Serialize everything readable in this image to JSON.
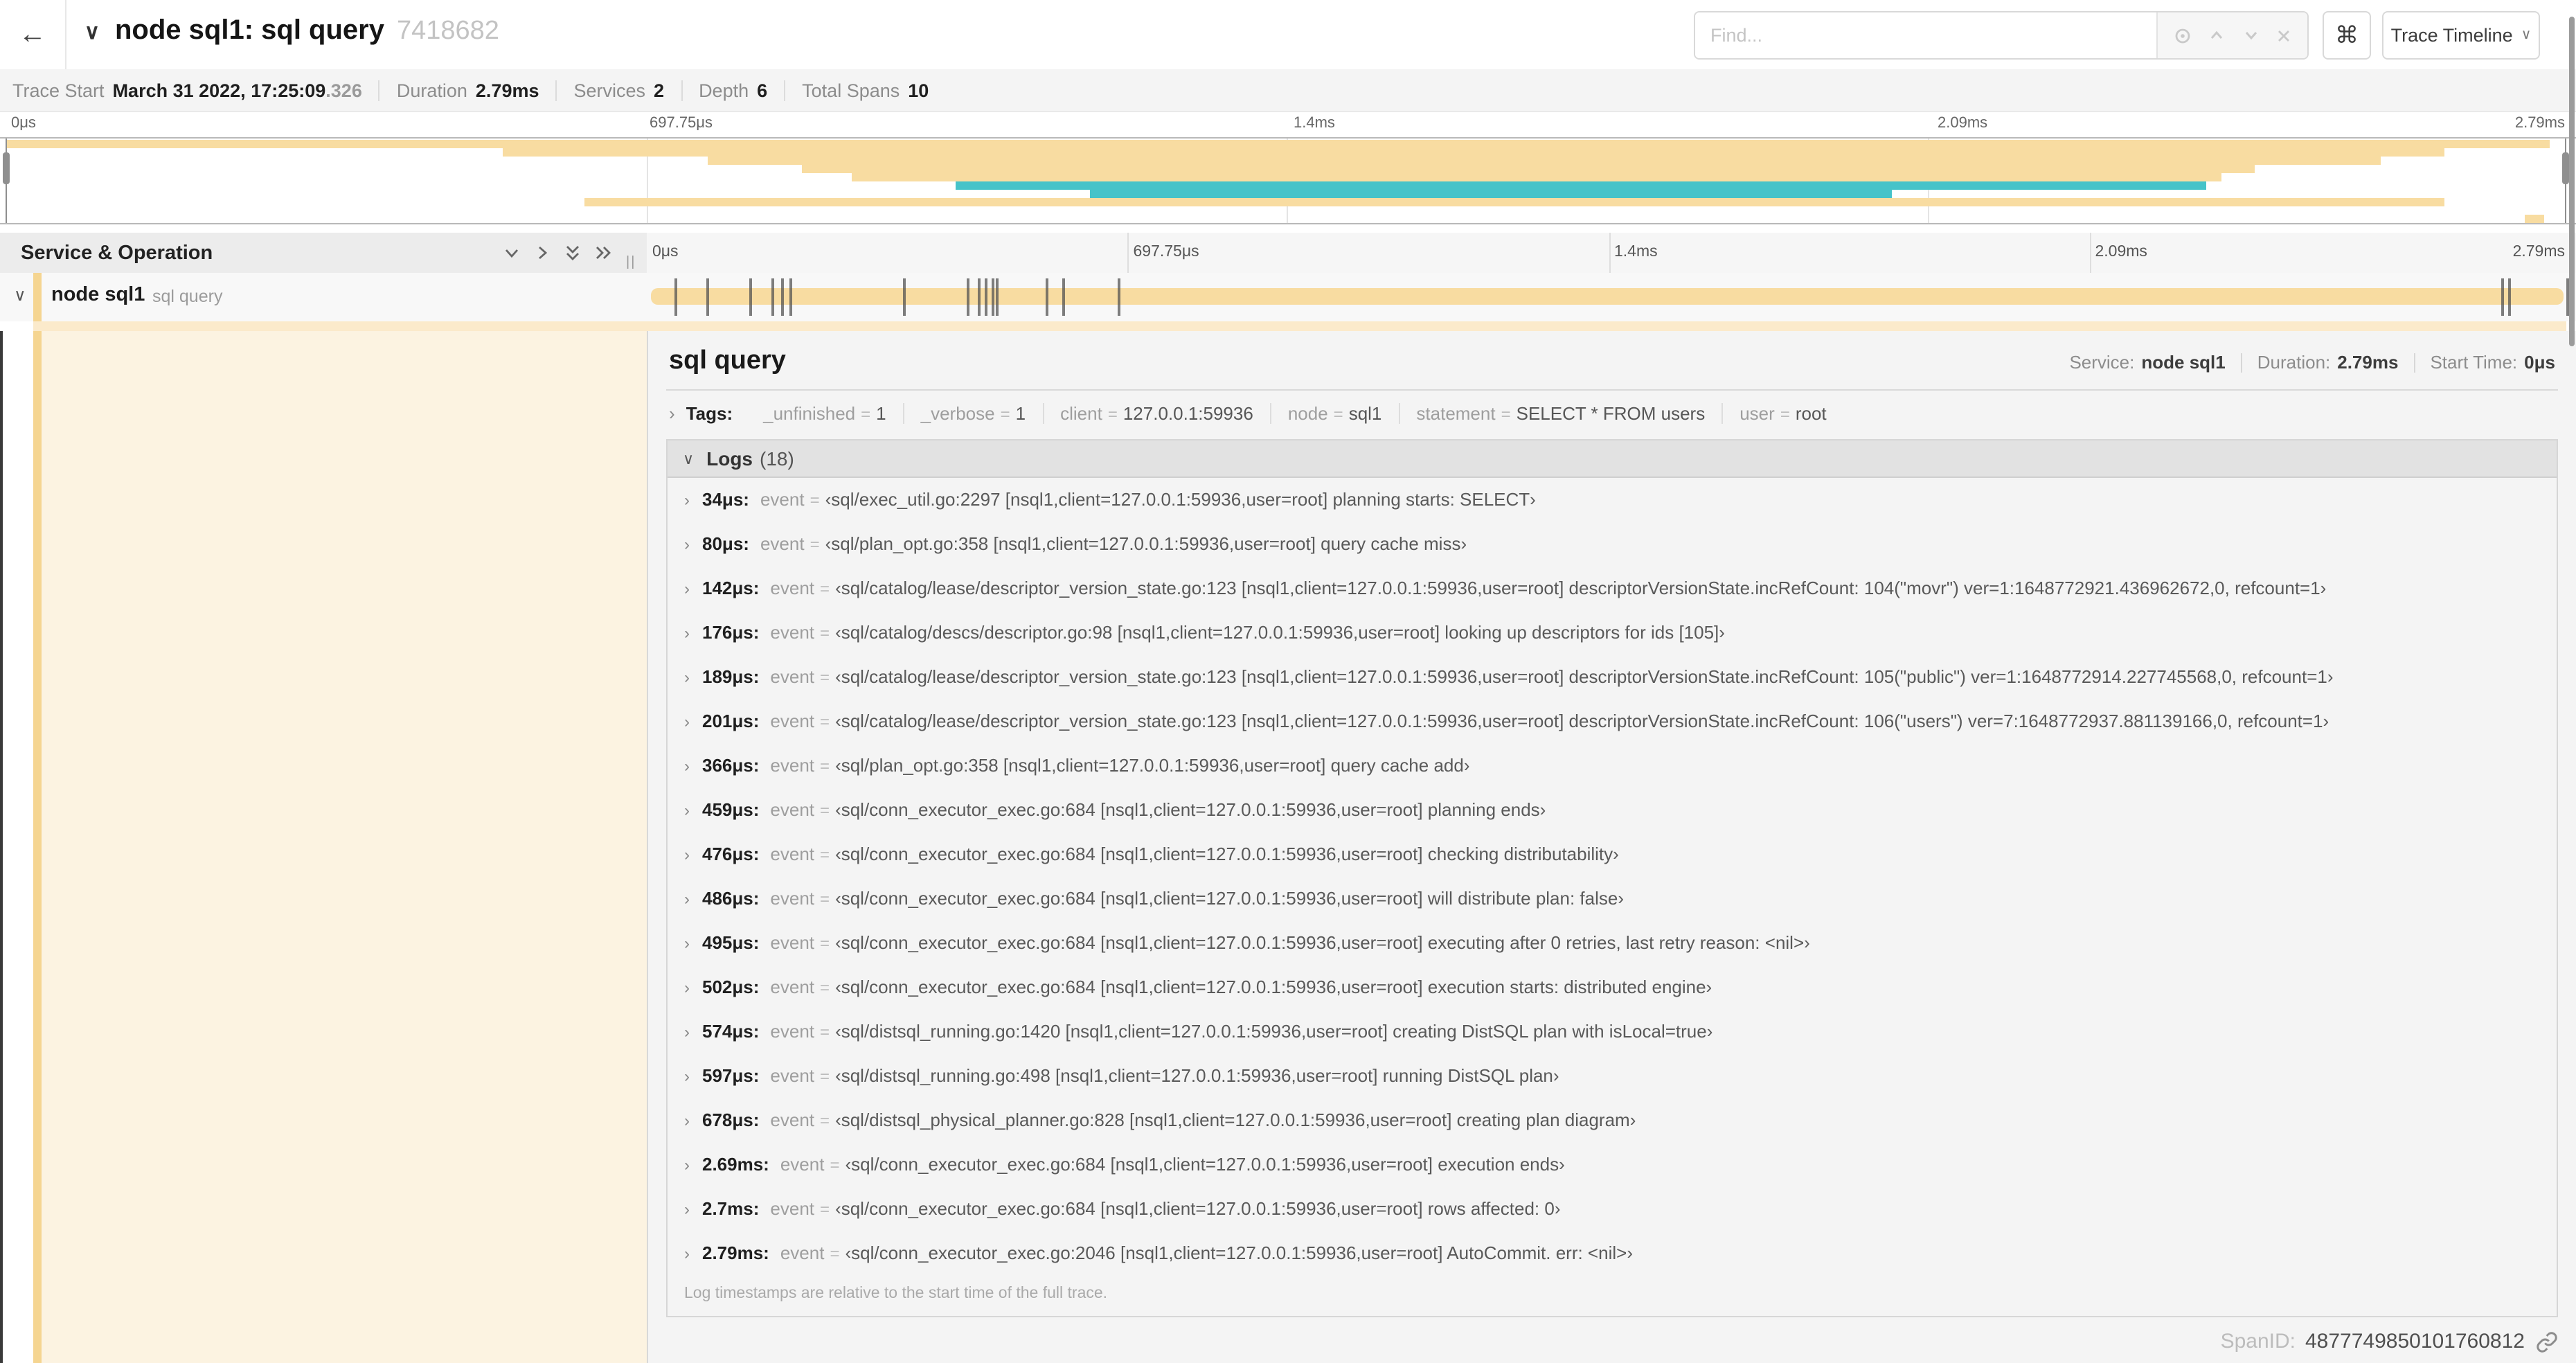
{
  "colors": {
    "tan": "#F8DCA1",
    "teal": "#46C3C9",
    "strip": "#F5D591",
    "band": "#FBEACB",
    "cream": "#FCF3E1"
  },
  "header": {
    "back_label": "←",
    "collapse_chevron": "∨",
    "title": "node sql1: sql query",
    "trace_id": "7418682",
    "find_placeholder": "Find...",
    "shortcut_label": "⌘",
    "view_select_label": "Trace Timeline"
  },
  "trace_info": {
    "items": [
      {
        "label": "Trace Start",
        "value": "March 31 2022, 17:25:09",
        "suffix": ".326"
      },
      {
        "label": "Duration",
        "value": "2.79ms",
        "suffix": ""
      },
      {
        "label": "Services",
        "value": "2",
        "suffix": ""
      },
      {
        "label": "Depth",
        "value": "6",
        "suffix": ""
      },
      {
        "label": "Total Spans",
        "value": "10",
        "suffix": ""
      }
    ]
  },
  "minimap": {
    "ticks": [
      {
        "label": "0μs",
        "pct": 0
      },
      {
        "label": "697.75μs",
        "pct": 25
      },
      {
        "label": "1.4ms",
        "pct": 50
      },
      {
        "label": "2.09ms",
        "pct": 75
      },
      {
        "label": "2.79ms",
        "pct": 100
      }
    ],
    "spans": [
      {
        "left": 0,
        "width": 99.3,
        "color": "tan"
      },
      {
        "left": 19.4,
        "width": 75.8,
        "color": "tan"
      },
      {
        "left": 27.4,
        "width": 65.3,
        "color": "tan"
      },
      {
        "left": 31.1,
        "width": 56.7,
        "color": "tan"
      },
      {
        "left": 33.0,
        "width": 53.5,
        "color": "tan"
      },
      {
        "left": 37.1,
        "width": 48.8,
        "color": "teal"
      },
      {
        "left": 42.3,
        "width": 31.3,
        "color": "teal"
      },
      {
        "left": 22.6,
        "width": 72.6,
        "color": "tan"
      },
      {
        "left": 0,
        "width": 0,
        "color": "tan"
      },
      {
        "left": 98.3,
        "width": 0.8,
        "color": "tan"
      }
    ]
  },
  "timeline": {
    "left_header": "Service & Operation",
    "splitter_glyph": "||",
    "ticks": [
      {
        "label": "0μs",
        "pct": 0
      },
      {
        "label": "697.75μs",
        "pct": 25
      },
      {
        "label": "1.4ms",
        "pct": 50
      },
      {
        "label": "2.09ms",
        "pct": 75
      },
      {
        "label": "2.79ms",
        "pct": 100
      }
    ],
    "row": {
      "chevron": "∨",
      "service": "node sql1",
      "operation": "sql query"
    },
    "total_us": 2790
  },
  "detail": {
    "title": "sql query",
    "overview": [
      {
        "label": "Service:",
        "value": "node sql1"
      },
      {
        "label": "Duration:",
        "value": "2.79ms"
      },
      {
        "label": "Start Time:",
        "value": "0μs"
      }
    ],
    "tags_label": "Tags:",
    "tags": [
      {
        "key": "_unfinished",
        "value": "1"
      },
      {
        "key": "_verbose",
        "value": "1"
      },
      {
        "key": "client",
        "value": "127.0.0.1:59936"
      },
      {
        "key": "node",
        "value": "sql1"
      },
      {
        "key": "statement",
        "value": "SELECT * FROM users"
      },
      {
        "key": "user",
        "value": "root"
      }
    ],
    "logs_label": "Logs",
    "logs_count": "(18)",
    "log_key": "event",
    "logs": [
      {
        "time": "34μs:",
        "t_us": 34,
        "value": "‹sql/exec_util.go:2297 [nsql1,client=127.0.0.1:59936,user=root] planning starts: SELECT›"
      },
      {
        "time": "80μs:",
        "t_us": 80,
        "value": "‹sql/plan_opt.go:358 [nsql1,client=127.0.0.1:59936,user=root] query cache miss›"
      },
      {
        "time": "142μs:",
        "t_us": 142,
        "value": "‹sql/catalog/lease/descriptor_version_state.go:123 [nsql1,client=127.0.0.1:59936,user=root] descriptorVersionState.incRefCount: 104(\"movr\") ver=1:1648772921.436962672,0, refcount=1›"
      },
      {
        "time": "176μs:",
        "t_us": 176,
        "value": "‹sql/catalog/descs/descriptor.go:98 [nsql1,client=127.0.0.1:59936,user=root] looking up descriptors for ids [105]›"
      },
      {
        "time": "189μs:",
        "t_us": 189,
        "value": "‹sql/catalog/lease/descriptor_version_state.go:123 [nsql1,client=127.0.0.1:59936,user=root] descriptorVersionState.incRefCount: 105(\"public\") ver=1:1648772914.227745568,0, refcount=1›"
      },
      {
        "time": "201μs:",
        "t_us": 201,
        "value": "‹sql/catalog/lease/descriptor_version_state.go:123 [nsql1,client=127.0.0.1:59936,user=root] descriptorVersionState.incRefCount: 106(\"users\") ver=7:1648772937.881139166,0, refcount=1›"
      },
      {
        "time": "366μs:",
        "t_us": 366,
        "value": "‹sql/plan_opt.go:358 [nsql1,client=127.0.0.1:59936,user=root] query cache add›"
      },
      {
        "time": "459μs:",
        "t_us": 459,
        "value": "‹sql/conn_executor_exec.go:684 [nsql1,client=127.0.0.1:59936,user=root] planning ends›"
      },
      {
        "time": "476μs:",
        "t_us": 476,
        "value": "‹sql/conn_executor_exec.go:684 [nsql1,client=127.0.0.1:59936,user=root] checking distributability›"
      },
      {
        "time": "486μs:",
        "t_us": 486,
        "value": "‹sql/conn_executor_exec.go:684 [nsql1,client=127.0.0.1:59936,user=root] will distribute plan: false›"
      },
      {
        "time": "495μs:",
        "t_us": 495,
        "value": "‹sql/conn_executor_exec.go:684 [nsql1,client=127.0.0.1:59936,user=root] executing after 0 retries, last retry reason: <nil>›"
      },
      {
        "time": "502μs:",
        "t_us": 502,
        "value": "‹sql/conn_executor_exec.go:684 [nsql1,client=127.0.0.1:59936,user=root] execution starts: distributed engine›"
      },
      {
        "time": "574μs:",
        "t_us": 574,
        "value": "‹sql/distsql_running.go:1420 [nsql1,client=127.0.0.1:59936,user=root] creating DistSQL plan with isLocal=true›"
      },
      {
        "time": "597μs:",
        "t_us": 597,
        "value": "‹sql/distsql_running.go:498 [nsql1,client=127.0.0.1:59936,user=root] running DistSQL plan›"
      },
      {
        "time": "678μs:",
        "t_us": 678,
        "value": "‹sql/distsql_physical_planner.go:828 [nsql1,client=127.0.0.1:59936,user=root] creating plan diagram›"
      },
      {
        "time": "2.69ms:",
        "t_us": 2690,
        "value": "‹sql/conn_executor_exec.go:684 [nsql1,client=127.0.0.1:59936,user=root] execution ends›"
      },
      {
        "time": "2.7ms:",
        "t_us": 2700,
        "value": "‹sql/conn_executor_exec.go:684 [nsql1,client=127.0.0.1:59936,user=root] rows affected: 0›"
      },
      {
        "time": "2.79ms:",
        "t_us": 2790,
        "value": "‹sql/conn_executor_exec.go:2046 [nsql1,client=127.0.0.1:59936,user=root] AutoCommit. err: <nil>›"
      }
    ],
    "note": "Log timestamps are relative to the start time of the full trace.",
    "span_id_label": "SpanID:",
    "span_id": "4877749850101760812"
  }
}
